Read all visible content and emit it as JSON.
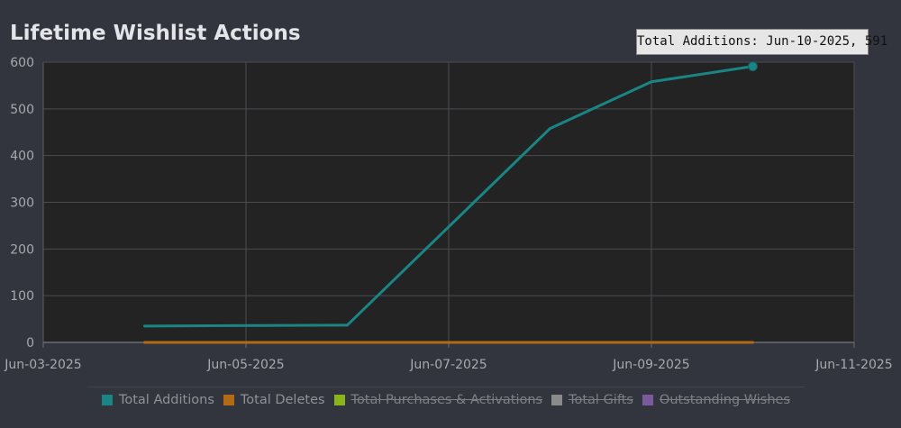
{
  "title": "Lifetime Wishlist Actions",
  "tooltip": {
    "text": "Total Additions: Jun-10-2025, 591"
  },
  "chart_data": {
    "type": "line",
    "title": "Lifetime Wishlist Actions",
    "xlabel": "",
    "ylabel": "",
    "x_ticks": [
      "Jun-03-2025",
      "Jun-05-2025",
      "Jun-07-2025",
      "Jun-09-2025",
      "Jun-11-2025"
    ],
    "xlim": [
      "Jun-03-2025",
      "Jun-11-2025"
    ],
    "ylim": [
      0,
      600
    ],
    "y_ticks": [
      "0",
      "100",
      "200",
      "300",
      "400",
      "500",
      "600"
    ],
    "grid": true,
    "legend_position": "bottom",
    "x": [
      "Jun-04-2025",
      "Jun-06-2025",
      "Jun-08-2025",
      "Jun-09-2025",
      "Jun-10-2025"
    ],
    "series": [
      {
        "name": "Total Additions",
        "color": "#1a8584",
        "visible": true,
        "values": [
          35,
          37,
          458,
          558,
          591
        ]
      },
      {
        "name": "Total Deletes",
        "color": "#b26a16",
        "visible": true,
        "values": [
          0,
          0,
          0,
          0,
          0
        ]
      },
      {
        "name": "Total Purchases & Activations",
        "color": "#8bb31a",
        "visible": false,
        "values": []
      },
      {
        "name": "Total Gifts",
        "color": "#8a8a8a",
        "visible": false,
        "values": []
      },
      {
        "name": "Outstanding Wishes",
        "color": "#7b5a9c",
        "visible": false,
        "values": []
      }
    ]
  }
}
